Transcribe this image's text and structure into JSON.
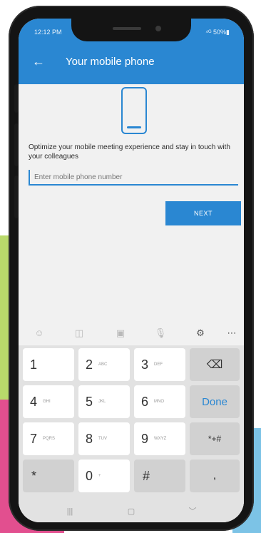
{
  "status": {
    "time": "12:12 PM",
    "right": "⁴ᴳ 50%▮"
  },
  "appbar": {
    "title": "Your mobile phone",
    "back_icon": "arrow-left-icon"
  },
  "content": {
    "description": "Optimize your mobile meeting experience and stay in touch with your colleagues",
    "input_placeholder": "Enter mobile phone number",
    "next_label": "NEXT"
  },
  "keyboard": {
    "toolbar_icons": [
      "emoji-icon",
      "sticker-icon",
      "gif-icon",
      "mic-icon",
      "settings-icon",
      "more-icon"
    ],
    "rows": [
      [
        {
          "num": "1",
          "sub": ""
        },
        {
          "num": "2",
          "sub": "ABC"
        },
        {
          "num": "3",
          "sub": "DEF"
        },
        {
          "special": "⌫"
        }
      ],
      [
        {
          "num": "4",
          "sub": "GHI"
        },
        {
          "num": "5",
          "sub": "JKL"
        },
        {
          "num": "6",
          "sub": "MNO"
        },
        {
          "special": "Done"
        }
      ],
      [
        {
          "num": "7",
          "sub": "PQRS"
        },
        {
          "num": "8",
          "sub": "TUV"
        },
        {
          "num": "9",
          "sub": "WXYZ"
        },
        {
          "special": "*+#"
        }
      ],
      [
        {
          "num": "*",
          "sub": ""
        },
        {
          "num": "0",
          "sub": "+"
        },
        {
          "num": "#",
          "sub": ""
        },
        {
          "special": ","
        }
      ]
    ]
  },
  "navbar": {
    "recent": "|||",
    "home": "▢",
    "back": "﹀"
  },
  "colors": {
    "accent": "#2a87d2",
    "screen_bg": "#f1f1f1",
    "keyboard_bg": "#e2e2e2"
  }
}
